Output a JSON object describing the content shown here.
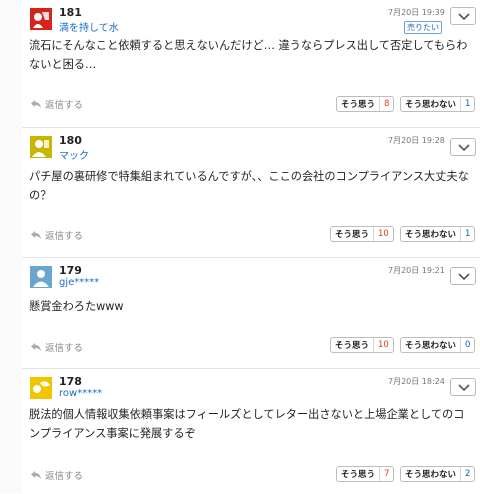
{
  "comments": [
    {
      "number": "181",
      "username": "満を持して水",
      "date": "7月20日 19:39",
      "badge": "売りたい",
      "text": "流石にそんなこと依頼すると思えないんだけど… 違うならプレス出して否定してもらわないと困る…",
      "reply_label": "返信する",
      "agree_label": "そう思う",
      "agree_count": "8",
      "disagree_label": "そう思わない",
      "disagree_count": "1",
      "avatar_color": "#d6241d"
    },
    {
      "number": "180",
      "username": "マック",
      "date": "7月20日 19:28",
      "text": "パチ屋の裏研修で特集組まれているんですが、、ここの会社のコンプライアンス大丈夫なの？",
      "reply_label": "返信する",
      "agree_label": "そう思う",
      "agree_count": "10",
      "disagree_label": "そう思わない",
      "disagree_count": "1",
      "avatar_color": "#c9b400"
    },
    {
      "number": "179",
      "username": "gje*****",
      "date": "7月20日 19:21",
      "text": "懸賞金わろたwww",
      "reply_label": "返信する",
      "agree_label": "そう思う",
      "agree_count": "10",
      "disagree_label": "そう思わない",
      "disagree_count": "0",
      "avatar_color": "#6aa5cf"
    },
    {
      "number": "178",
      "username": "row*****",
      "date": "7月20日 18:24",
      "text": "脱法的個人情報収集依頼事案はフィールズとしてレター出さないと上場企業としてのコンプライアンス事案に発展するぞ",
      "reply_label": "返信する",
      "agree_label": "そう思う",
      "agree_count": "7",
      "disagree_label": "そう思わない",
      "disagree_count": "2",
      "avatar_color": "#f2c500"
    }
  ],
  "icons": {
    "menu": "chevron-down-icon",
    "reply": "reply-arrow-icon",
    "avatar": "user-avatar-icon"
  },
  "colors": {
    "username_link": "#1a6fc9",
    "agree_count": "#d9401e",
    "disagree_count": "#1a5fc0"
  }
}
